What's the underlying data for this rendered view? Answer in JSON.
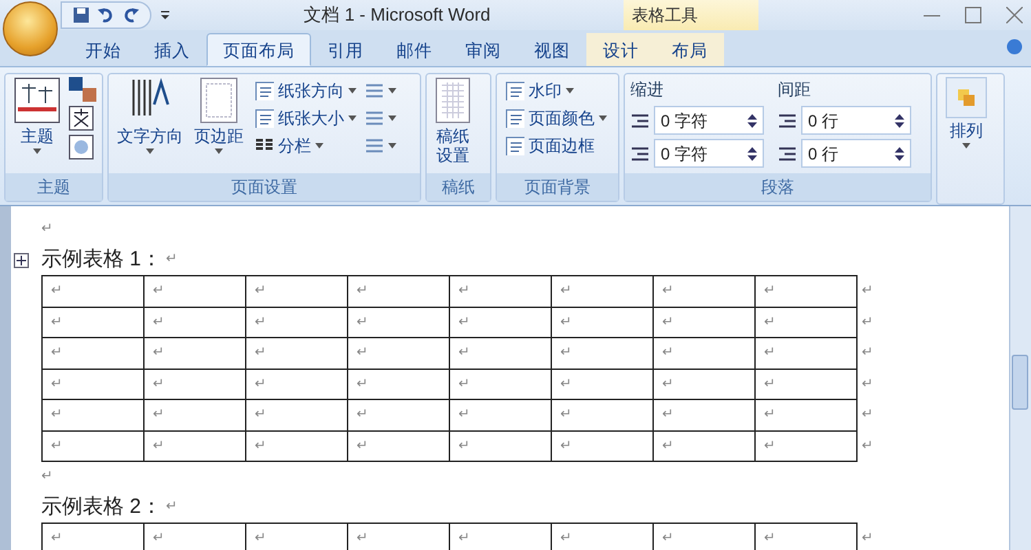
{
  "window": {
    "title": "文档 1 - Microsoft Word",
    "context_label": "表格工具"
  },
  "tabs": [
    {
      "label": "开始",
      "selected": false,
      "contextual": false
    },
    {
      "label": "插入",
      "selected": false,
      "contextual": false
    },
    {
      "label": "页面布局",
      "selected": true,
      "contextual": false
    },
    {
      "label": "引用",
      "selected": false,
      "contextual": false
    },
    {
      "label": "邮件",
      "selected": false,
      "contextual": false
    },
    {
      "label": "审阅",
      "selected": false,
      "contextual": false
    },
    {
      "label": "视图",
      "selected": false,
      "contextual": false
    },
    {
      "label": "设计",
      "selected": false,
      "contextual": true
    },
    {
      "label": "布局",
      "selected": false,
      "contextual": true
    }
  ],
  "ribbon": {
    "theme": {
      "label": "主题",
      "button": "主题"
    },
    "page_setup": {
      "label": "页面设置",
      "big": [
        "文字方向",
        "页边距"
      ],
      "small": [
        "纸张方向",
        "纸张大小",
        "分栏"
      ]
    },
    "manuscript": {
      "label": "稿纸",
      "button": "稿纸设置"
    },
    "background": {
      "label": "页面背景",
      "items": [
        "水印",
        "页面颜色",
        "页面边框"
      ]
    },
    "paragraph": {
      "label": "段落",
      "indent_label": "缩进",
      "spacing_label": "间距",
      "indent": [
        "0 字符",
        "0 字符"
      ],
      "spacing": [
        "0 行",
        "0 行"
      ]
    },
    "arrange": {
      "button": "排列"
    }
  },
  "document": {
    "blocks": [
      {
        "kind": "para",
        "text": "↵"
      },
      {
        "kind": "caption",
        "text": "示例表格 1：",
        "mark": "↵"
      },
      {
        "kind": "table",
        "rows": [
          {
            "cells": [
              "↵",
              "↵",
              "↵",
              "↵",
              "↵",
              "↵",
              "↵",
              "↵"
            ],
            "end": "↵"
          },
          {
            "cells": [
              "↵",
              "↵",
              "↵",
              "↵",
              "↵",
              "↵",
              "↵",
              "↵"
            ],
            "end": "↵"
          },
          {
            "cells": [
              "↵",
              "↵",
              "↵",
              "↵",
              "↵",
              "↵",
              "↵",
              "↵"
            ],
            "end": "↵"
          },
          {
            "cells": [
              "↵",
              "↵",
              "↵",
              "↵",
              "↵",
              "↵",
              "↵",
              "↵"
            ],
            "end": "↵"
          },
          {
            "cells": [
              "↵",
              "↵",
              "↵",
              "↵",
              "↵",
              "↵",
              "↵",
              "↵"
            ],
            "end": "↵"
          },
          {
            "cells": [
              "↵",
              "↵",
              "↵",
              "↵",
              "↵",
              "↵",
              "↵",
              "↵"
            ],
            "end": "↵"
          }
        ]
      },
      {
        "kind": "para",
        "text": "↵"
      },
      {
        "kind": "caption",
        "text": "示例表格 2：",
        "mark": "↵"
      },
      {
        "kind": "table",
        "rows": [
          {
            "cells": [
              "↵",
              "↵",
              "↵",
              "↵",
              "↵",
              "↵",
              "↵",
              "↵"
            ],
            "end": "↵"
          }
        ]
      }
    ]
  }
}
